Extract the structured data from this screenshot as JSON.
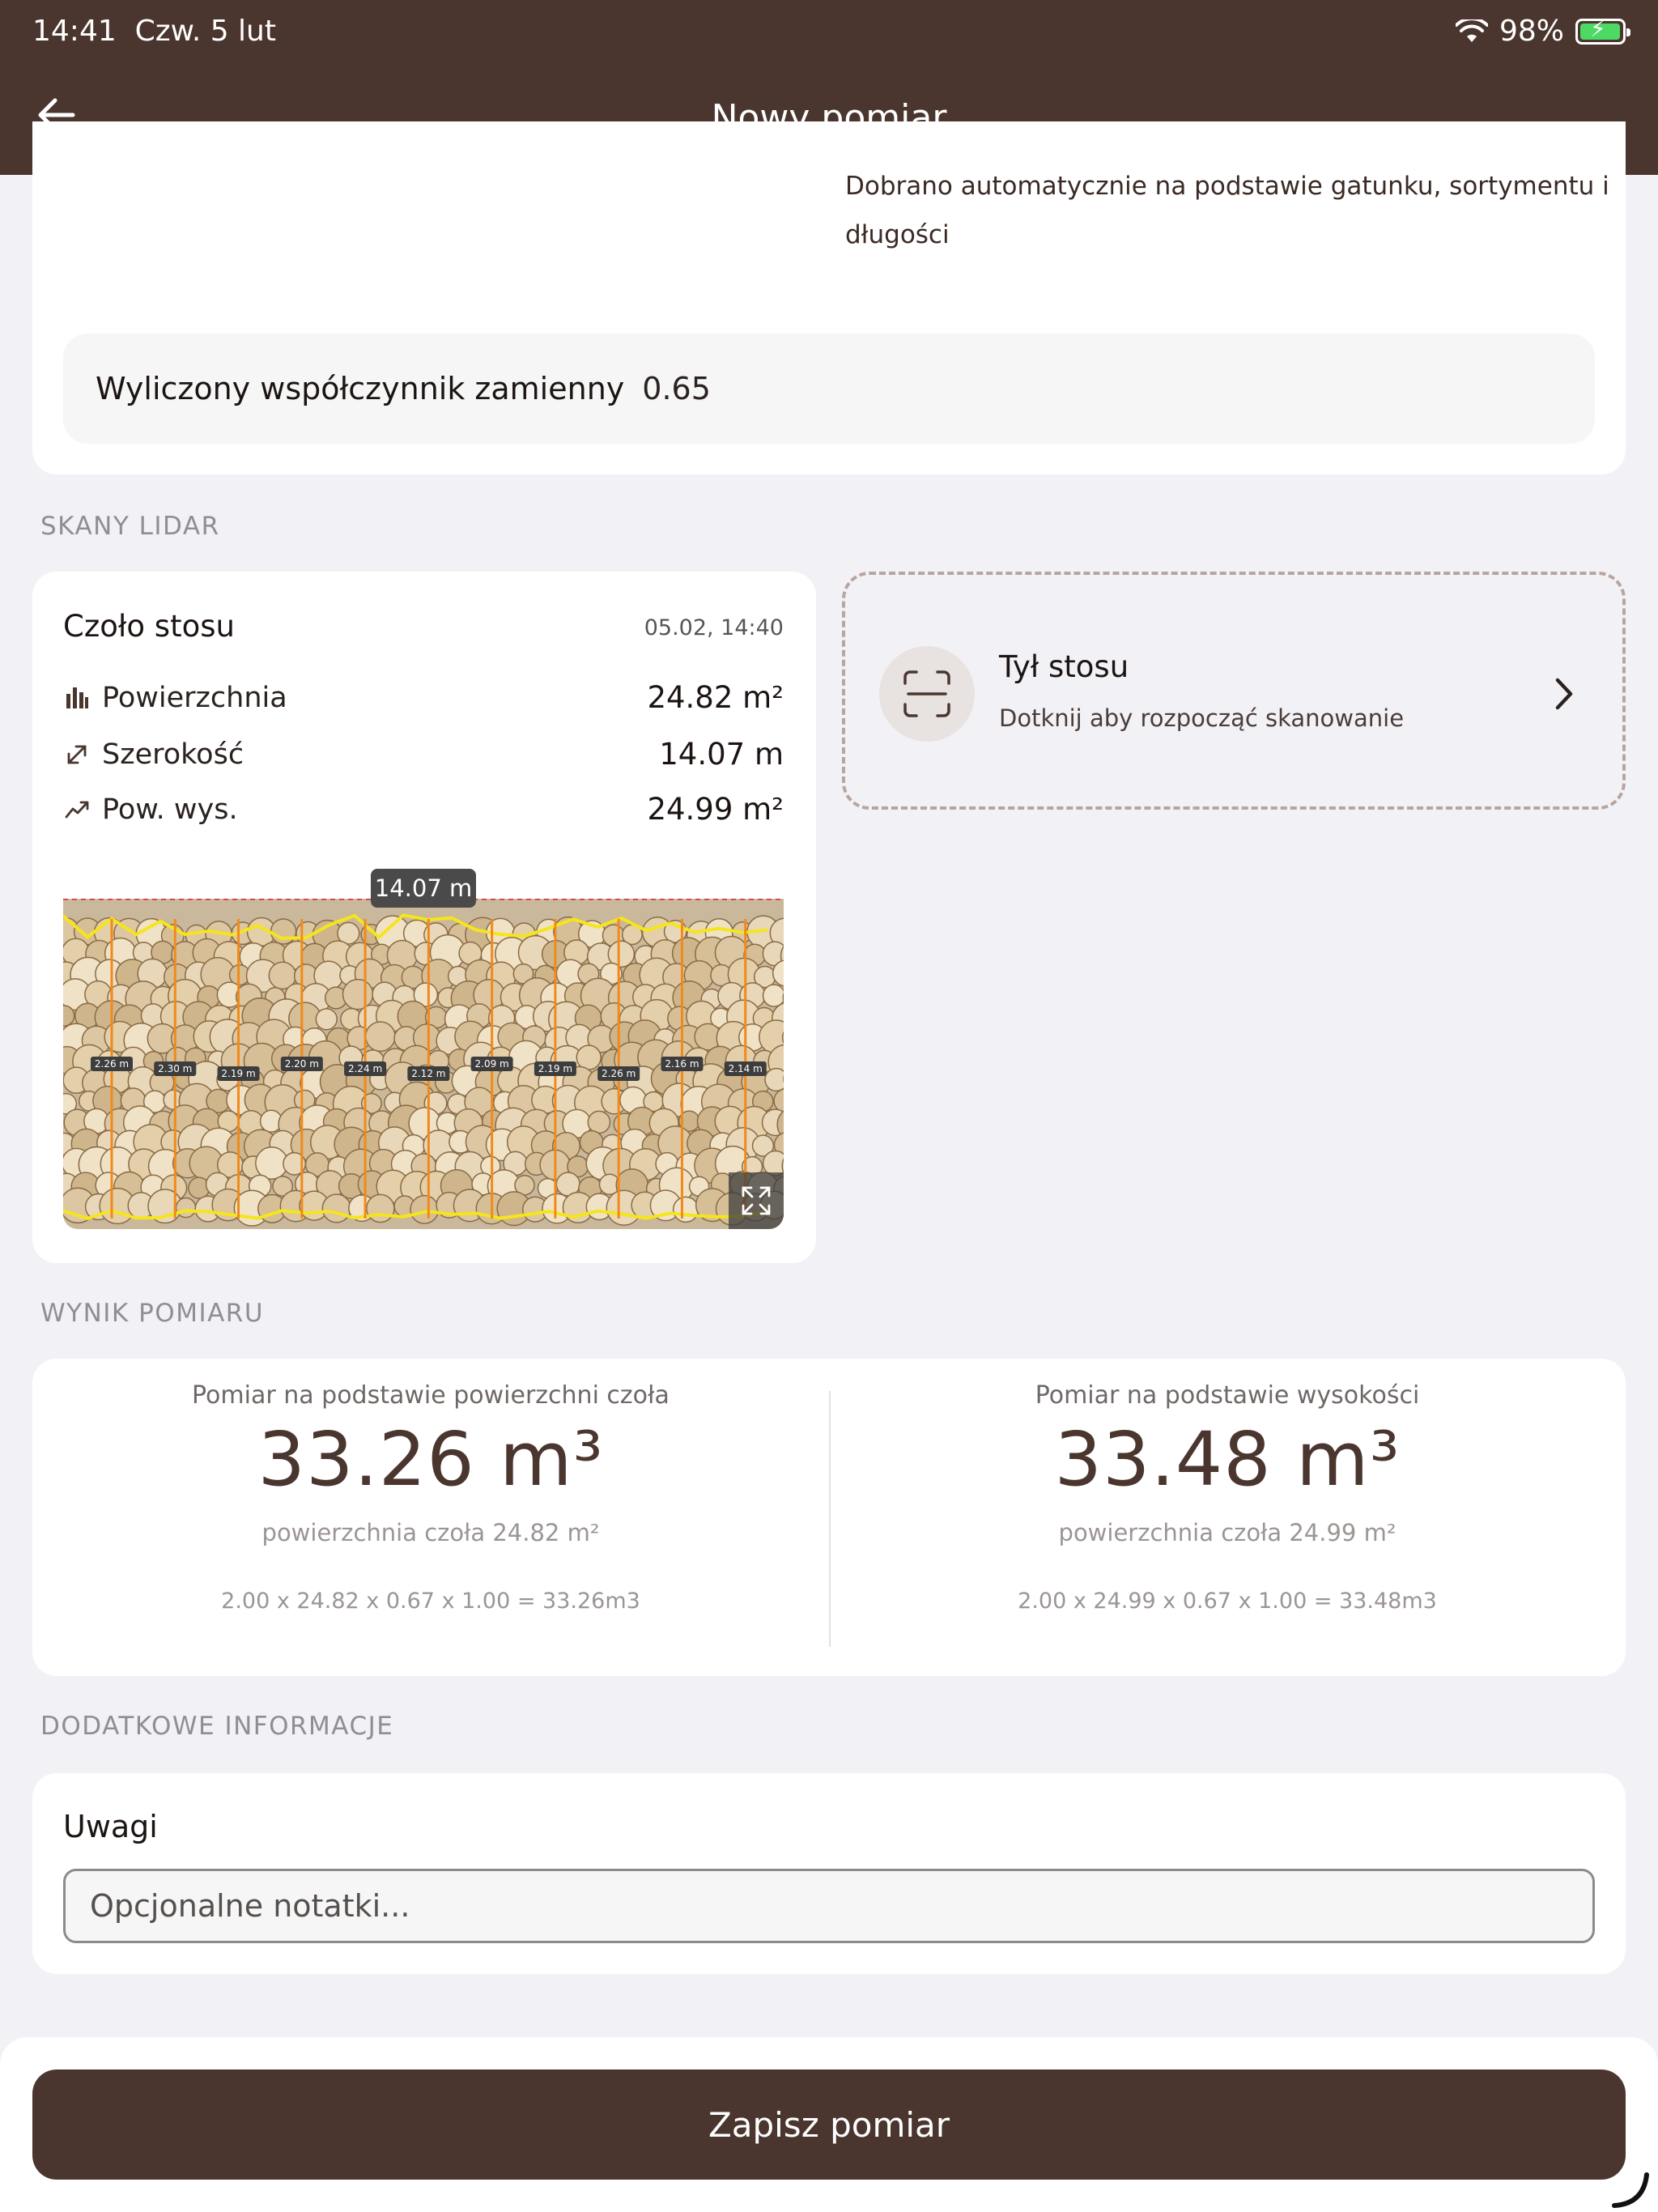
{
  "status_bar": {
    "time": "14:41",
    "date": "Czw. 5 lut",
    "battery": "98%",
    "battery_level": 0.98
  },
  "nav": {
    "title": "Nowy pomiar",
    "back_icon": "arrow-left-icon"
  },
  "factor": {
    "note": "Dobrano automatycznie na podstawie gatunku, sortymentu i długości",
    "label": "Wyliczony współczynnik zamienny",
    "value": "0.65"
  },
  "lidar": {
    "section_label": "SKANY LIDAR",
    "front": {
      "title": "Czoło stosu",
      "date": "05.02, 14:40",
      "metrics": [
        {
          "icon": "bar-chart-icon",
          "label": "Powierzchnia",
          "value": "24.82 m²"
        },
        {
          "icon": "diagonal-arrow-icon",
          "label": "Szerokość",
          "value": "14.07 m"
        },
        {
          "icon": "trend-line-icon",
          "label": "Pow. wys.",
          "value": "24.99 m²"
        }
      ],
      "image_width_label": "14.07 m",
      "segment_labels": [
        "2.26 m",
        "2.30 m",
        "2.19 m",
        "2.20 m",
        "2.24 m",
        "2.12 m",
        "2.09 m",
        "2.19 m",
        "2.26 m",
        "2.16 m",
        "2.14 m"
      ]
    },
    "back": {
      "title": "Tył stosu",
      "subtitle": "Dotknij aby rozpocząć skanowanie"
    }
  },
  "result": {
    "section_label": "WYNIK POMIARU",
    "left": {
      "caption": "Pomiar na podstawie powierzchni czoła",
      "value": "33.26 m³",
      "sub": "powierzchnia czoła 24.82 m²",
      "formula": "2.00 x 24.82 x 0.67 x 1.00 = 33.26m3"
    },
    "right": {
      "caption": "Pomiar na podstawie wysokości",
      "value": "33.48 m³",
      "sub": "powierzchnia czoła 24.99 m²",
      "formula": "2.00 x 24.99 x 0.67 x 1.00 = 33.48m3"
    }
  },
  "extra": {
    "section_label": "DODATKOWE INFORMACJE",
    "notes_label": "Uwagi",
    "notes_placeholder": "Opcjonalne notatki...",
    "notes_value": ""
  },
  "actions": {
    "save_label": "Zapisz pomiar"
  },
  "colors": {
    "brand": "#4a362f",
    "background": "#f2f1f6",
    "card": "#ffffff",
    "measure_line": "#f5e51c",
    "segment_line": "#f08a1c"
  }
}
